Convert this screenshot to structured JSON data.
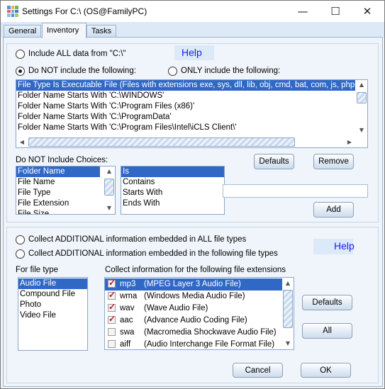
{
  "window": {
    "title": "Settings For C:\\ (OS@FamilyPC)",
    "minimize": "—",
    "maximize": "☐",
    "close": "✕"
  },
  "tabs": [
    {
      "label": "General"
    },
    {
      "label": "Inventory",
      "active": true
    },
    {
      "label": "Tasks"
    }
  ],
  "inventory": {
    "radio_all": "Include ALL data from \"C:\\\"",
    "radio_not": "Do NOT include the following:",
    "radio_only": "ONLY include the following:",
    "selected_mode": "Do NOT include the following:",
    "help": "Help",
    "rules": [
      "File Type Is Executable File (Files with extensions exe, sys, dll, lib, obj, cmd, bat, com, js, php, pl, p",
      "Folder Name Starts With 'C:\\WINDOWS'",
      "Folder Name Starts With 'C:\\Program Files (x86)'",
      "Folder Name Starts With 'C:\\ProgramData'",
      "Folder Name Starts With 'C:\\Program Files\\Intel\\iCLS Client\\'"
    ],
    "choices_label": "Do NOT Include Choices:",
    "fields": [
      "Folder Name",
      "File Name",
      "File Type",
      "File Extension",
      "File Size"
    ],
    "operators": [
      "Is",
      "Contains",
      "Starts With",
      "Ends With"
    ],
    "value_input": "",
    "defaults": "Defaults",
    "remove": "Remove",
    "add": "Add"
  },
  "additional": {
    "radio_all": "Collect ADDITIONAL information embedded in ALL file types",
    "radio_following": "Collect ADDITIONAL information embedded in the following file types",
    "help": "Help",
    "file_type_label": "For file type",
    "file_types": [
      "Audio File",
      "Compound File",
      "Photo",
      "Video File"
    ],
    "ext_label": "Collect information for the following file extensions",
    "extensions": [
      {
        "ext": "mp3",
        "desc": "(MPEG Layer 3 Audio File)",
        "checked": true
      },
      {
        "ext": "wma",
        "desc": "(Windows Media Audio File)",
        "checked": true
      },
      {
        "ext": "wav",
        "desc": "(Wave Audio File)",
        "checked": true
      },
      {
        "ext": "aac",
        "desc": "(Advance Audio Coding File)",
        "checked": true
      },
      {
        "ext": "swa",
        "desc": "(Macromedia Shockwave Audio File)",
        "checked": false
      },
      {
        "ext": "aiff",
        "desc": "(Audio Interchange File Format File)",
        "checked": false
      }
    ],
    "defaults": "Defaults",
    "all": "All"
  },
  "footer": {
    "cancel": "Cancel",
    "ok": "OK"
  },
  "colors": {
    "selection": "#3068c6",
    "help_text": "#1a1aff"
  }
}
